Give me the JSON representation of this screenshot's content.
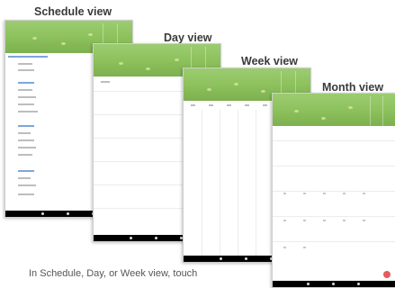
{
  "titles": {
    "schedule": "Schedule view",
    "day": "Day view",
    "week": "Week view",
    "month": "Month view"
  },
  "caption": "In Schedule, Day, or Week view, touch",
  "colors": {
    "header_green": "#8fc35e",
    "nav_bar": "#000000",
    "fab": "#e35d5d",
    "accent_blue": "#7fa6d6"
  },
  "icons": {
    "fab": "add-event-icon",
    "nav_back": "back-icon",
    "nav_home": "home-icon",
    "nav_recent": "recents-icon"
  }
}
